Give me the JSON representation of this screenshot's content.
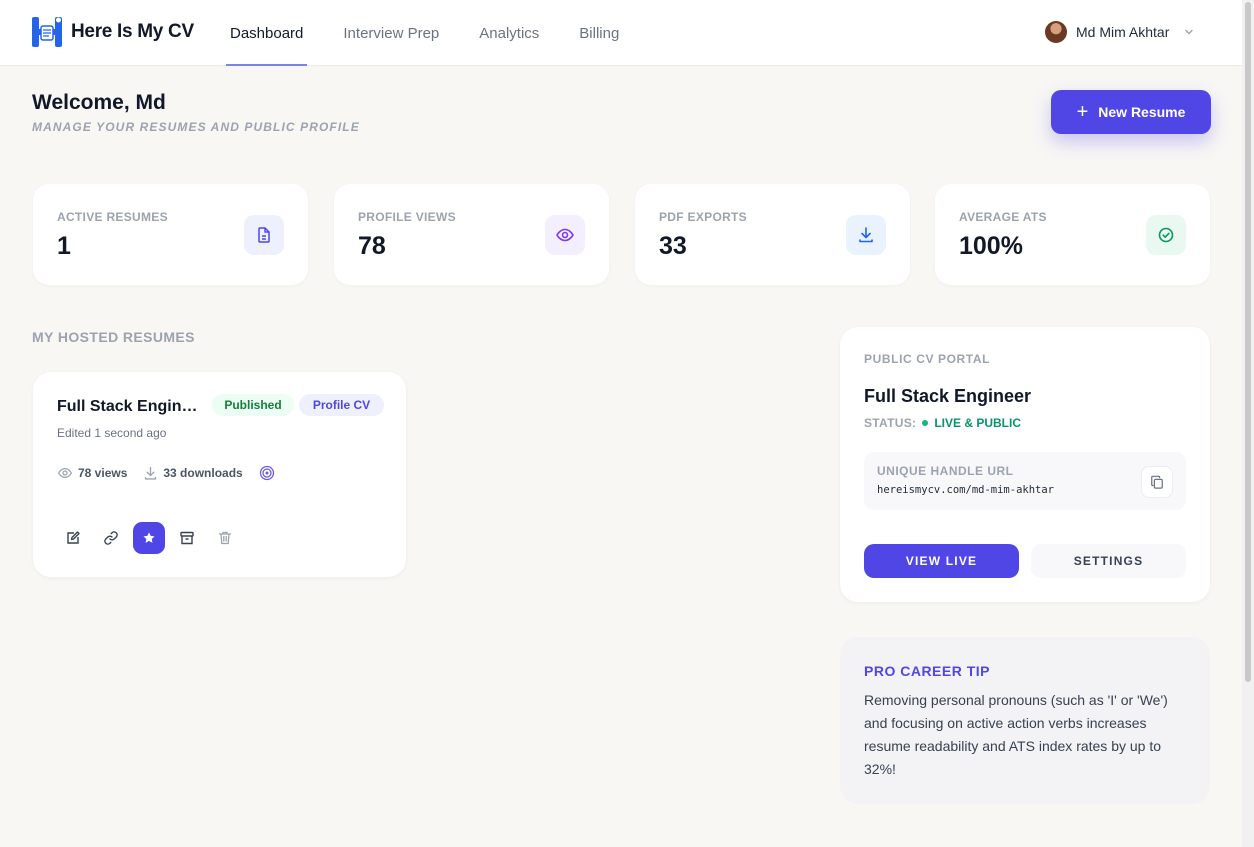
{
  "brand": {
    "name": "Here Is My CV"
  },
  "nav": {
    "items": [
      "Dashboard",
      "Interview Prep",
      "Analytics",
      "Billing"
    ],
    "active": "Dashboard"
  },
  "user": {
    "name": "Md Mim Akhtar"
  },
  "header": {
    "welcome": "Welcome, Md",
    "subtitle": "MANAGE YOUR RESUMES AND PUBLIC PROFILE",
    "new_button": "New Resume"
  },
  "stats": [
    {
      "label": "ACTIVE RESUMES",
      "value": "1",
      "icon": "document-icon",
      "color": "#4f46e5",
      "bg": "#eef0fe"
    },
    {
      "label": "PROFILE VIEWS",
      "value": "78",
      "icon": "eye-icon",
      "color": "#7c3aed",
      "bg": "#f3effe"
    },
    {
      "label": "PDF EXPORTS",
      "value": "33",
      "icon": "download-icon",
      "color": "#2563eb",
      "bg": "#eaf2fe"
    },
    {
      "label": "AVERAGE ATS",
      "value": "100%",
      "icon": "check-circle-icon",
      "color": "#059669",
      "bg": "#e9f9f1"
    }
  ],
  "hosted": {
    "section_title": "MY HOSTED RESUMES",
    "resume": {
      "title": "Full Stack Engineer",
      "badge_status": "Published",
      "badge_type": "Profile CV",
      "edited": "Edited 1 second ago",
      "views": "78 views",
      "downloads": "33 downloads"
    }
  },
  "portal": {
    "label": "PUBLIC CV PORTAL",
    "title": "Full Stack Engineer",
    "status_key": "STATUS:",
    "status_value": "LIVE & PUBLIC",
    "url_label": "UNIQUE HANDLE URL",
    "url_value": "hereismycv.com/md-mim-akhtar",
    "view_button": "VIEW LIVE",
    "settings_button": "SETTINGS"
  },
  "tip": {
    "title": "PRO CAREER TIP",
    "body": "Removing personal pronouns (such as 'I' or 'We') and focusing on active action verbs increases resume readability and ATS index rates by up to 32%!"
  },
  "colors": {
    "accent": "#4f46e5",
    "background": "#f8f7f4",
    "success": "#10b981"
  }
}
